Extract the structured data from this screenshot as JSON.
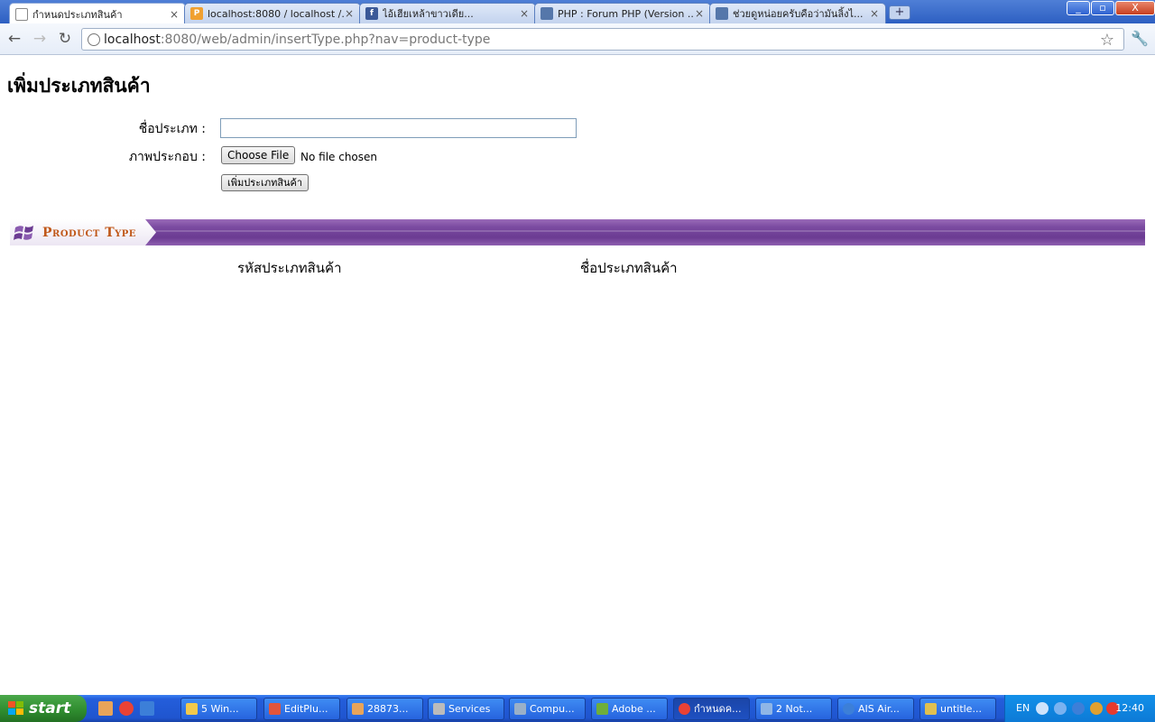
{
  "browser": {
    "tabs": [
      {
        "title": "กำหนดประเภทสินค้า",
        "icon": "page-icon",
        "active": true
      },
      {
        "title": "localhost:8080 / localhost /...",
        "icon": "phpmyadmin-icon",
        "active": false
      },
      {
        "title": "ไอ้เฮียเหล้าขาวเดีย...",
        "icon": "facebook-icon",
        "active": false
      },
      {
        "title": "PHP : Forum PHP (Version ...",
        "icon": "forum-icon",
        "active": false
      },
      {
        "title": "ช่วยดูหน่อยครับคือว่ามันลิ้งไ...",
        "icon": "forum-icon",
        "active": false
      }
    ],
    "new_tab": "+",
    "window_controls": {
      "minimize": "_",
      "restore": "▫",
      "close": "X"
    },
    "address": {
      "host": "localhost",
      "path": ":8080/web/admin/insertType.php?nav=product-type"
    }
  },
  "page": {
    "title": "เพิ่มประเภทสินค้า",
    "form": {
      "name_label": "ชื่อประเภท :",
      "name_value": "",
      "image_label": "ภาพประกอบ :",
      "file_button": "Choose File",
      "file_status": "No file chosen",
      "submit_button": "เพิ่มประเภทสินค้า"
    },
    "banner": {
      "text": "Product Type"
    },
    "table": {
      "headers": [
        "รหัสประเภทสินค้า",
        "ชื่อประเภทสินค้า"
      ]
    }
  },
  "taskbar": {
    "start": "start",
    "buttons": [
      {
        "label": "5 Win...",
        "icon_color": "#f2c94c"
      },
      {
        "label": "EditPlu...",
        "icon_color": "#e2553b"
      },
      {
        "label": "28873...",
        "icon_color": "#e8a45a"
      },
      {
        "label": "Services",
        "icon_color": "#bbbbbb"
      },
      {
        "label": "Compu...",
        "icon_color": "#9ab0c8"
      },
      {
        "label": "Adobe ...",
        "icon_color": "#6fae3a"
      },
      {
        "label": "กำหนดค...",
        "icon_color": "#e94235",
        "active": true
      },
      {
        "label": "2 Not...",
        "icon_color": "#8fb6e6"
      },
      {
        "label": "AIS Air...",
        "icon_color": "#3c7fd8"
      },
      {
        "label": "untitle...",
        "icon_color": "#e0c050"
      }
    ],
    "tray": {
      "language": "EN",
      "clock": "12:40"
    }
  }
}
